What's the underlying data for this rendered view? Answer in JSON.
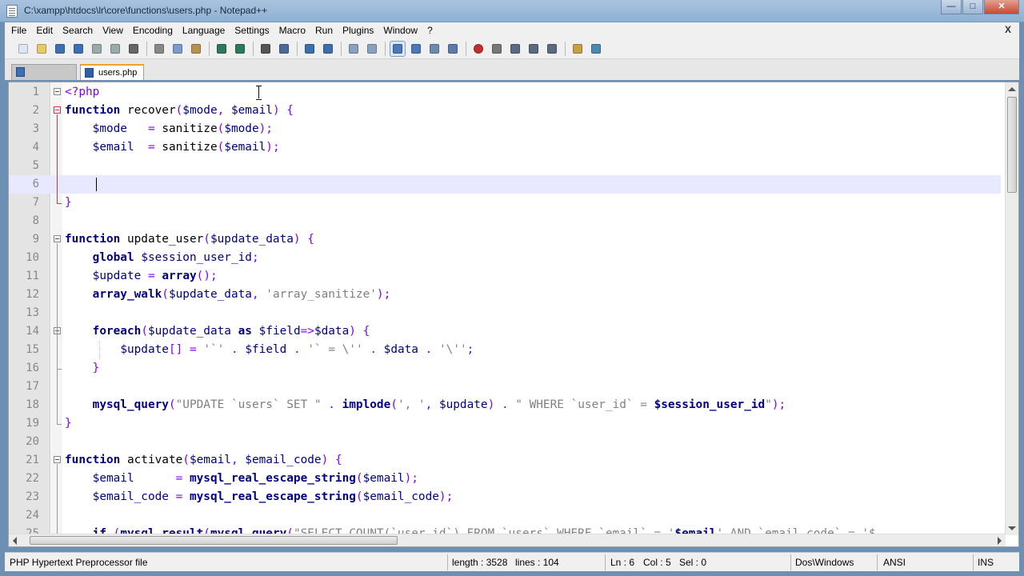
{
  "window": {
    "title": "C:\\xampp\\htdocs\\lr\\core\\functions\\users.php - Notepad++"
  },
  "menu": [
    "File",
    "Edit",
    "Search",
    "View",
    "Encoding",
    "Language",
    "Settings",
    "Macro",
    "Run",
    "Plugins",
    "Window",
    "?"
  ],
  "menu_close": "X",
  "tabs": [
    {
      "label": "",
      "active": false
    },
    {
      "label": "users.php",
      "active": true
    }
  ],
  "toolbar_icons": [
    "new-file-icon",
    "open-file-icon",
    "save-icon",
    "save-all-icon",
    "close-icon",
    "close-all-icon",
    "print-icon",
    "cut-icon",
    "copy-icon",
    "paste-icon",
    "undo-icon",
    "redo-icon",
    "find-icon",
    "replace-icon",
    "zoom-in-icon",
    "zoom-out-icon",
    "sync-vertical-icon",
    "sync-horizontal-icon",
    "word-wrap-icon",
    "show-all-chars-icon",
    "indent-guide-icon",
    "user-defined-language-icon",
    "record-macro-icon",
    "stop-macro-icon",
    "play-macro-icon",
    "run-macro-multiple-icon",
    "save-macro-icon",
    "open-folder-icon",
    "spell-check-icon"
  ],
  "editor": {
    "current_line": 6,
    "lines": [
      {
        "n": "1",
        "html": "<span class=\"op\">&lt;?php</span>"
      },
      {
        "n": "2",
        "html": "<span class=\"kw\">function</span> recover<span class=\"op\">(</span><span class=\"var\">$mode</span><span class=\"op\">,</span> <span class=\"var\">$email</span><span class=\"op\">)</span> <span class=\"op\">{</span>"
      },
      {
        "n": "3",
        "html": "    <span class=\"var\">$mode</span>   <span class=\"op\">=</span> sanitize<span class=\"op\">(</span><span class=\"var\">$mode</span><span class=\"op\">);</span>"
      },
      {
        "n": "4",
        "html": "    <span class=\"var\">$email</span>  <span class=\"op\">=</span> sanitize<span class=\"op\">(</span><span class=\"var\">$email</span><span class=\"op\">);</span>"
      },
      {
        "n": "5",
        "html": ""
      },
      {
        "n": "6",
        "html": ""
      },
      {
        "n": "7",
        "html": "<span class=\"op\">}</span>"
      },
      {
        "n": "8",
        "html": ""
      },
      {
        "n": "9",
        "html": "<span class=\"kw\">function</span> update_user<span class=\"op\">(</span><span class=\"var\">$update_data</span><span class=\"op\">)</span> <span class=\"op\">{</span>"
      },
      {
        "n": "10",
        "html": "    <span class=\"kw\">global</span> <span class=\"var\">$session_user_id</span><span class=\"op\">;</span>"
      },
      {
        "n": "11",
        "html": "    <span class=\"var\">$update</span> <span class=\"op\">=</span> <span class=\"cmd\">array</span><span class=\"op\">();</span>"
      },
      {
        "n": "12",
        "html": "    <span class=\"cmd\">array_walk</span><span class=\"op\">(</span><span class=\"var\">$update_data</span><span class=\"op\">,</span> <span class=\"str\">'array_sanitize'</span><span class=\"op\">);</span>"
      },
      {
        "n": "13",
        "html": ""
      },
      {
        "n": "14",
        "html": "    <span class=\"kw\">foreach</span><span class=\"op\">(</span><span class=\"var\">$update_data</span> <span class=\"kw\">as</span> <span class=\"var\">$field</span><span class=\"op\">=&gt;</span><span class=\"var\">$data</span><span class=\"op\">)</span> <span class=\"op\">{</span>"
      },
      {
        "n": "15",
        "html": "        <span class=\"var\">$update</span><span class=\"op\">[]</span> <span class=\"op\">=</span> <span class=\"str\">'`'</span> <span class=\"op\">.</span> <span class=\"var\">$field</span> <span class=\"op\">.</span> <span class=\"str\">'` = \\''</span> <span class=\"op\">.</span> <span class=\"var\">$data</span> <span class=\"op\">.</span> <span class=\"str\">'\\''</span><span class=\"op\">;</span>"
      },
      {
        "n": "16",
        "html": "    <span class=\"op\">}</span>"
      },
      {
        "n": "17",
        "html": ""
      },
      {
        "n": "18",
        "html": "    <span class=\"cmd\">mysql_query</span><span class=\"op\">(</span><span class=\"str\">\"UPDATE `users` SET \"</span> <span class=\"op\">.</span> <span class=\"cmd\">implode</span><span class=\"op\">(</span><span class=\"str\">', '</span><span class=\"op\">,</span> <span class=\"var\">$update</span><span class=\"op\">)</span> <span class=\"op\">.</span> <span class=\"str\">\" WHERE `user_id` = </span><span class=\"cmd\">$session_user_id</span><span class=\"str\">\"</span><span class=\"op\">);</span>"
      },
      {
        "n": "19",
        "html": "<span class=\"op\">}</span>"
      },
      {
        "n": "20",
        "html": ""
      },
      {
        "n": "21",
        "html": "<span class=\"kw\">function</span> activate<span class=\"op\">(</span><span class=\"var\">$email</span><span class=\"op\">,</span> <span class=\"var\">$email_code</span><span class=\"op\">)</span> <span class=\"op\">{</span>"
      },
      {
        "n": "22",
        "html": "    <span class=\"var\">$email</span>      <span class=\"op\">=</span> <span class=\"cmd\">mysql_real_escape_string</span><span class=\"op\">(</span><span class=\"var\">$email</span><span class=\"op\">);</span>"
      },
      {
        "n": "23",
        "html": "    <span class=\"var\">$email_code</span> <span class=\"op\">=</span> <span class=\"cmd\">mysql_real_escape_string</span><span class=\"op\">(</span><span class=\"var\">$email_code</span><span class=\"op\">);</span>"
      },
      {
        "n": "24",
        "html": ""
      },
      {
        "n": "25",
        "html": "    <span class=\"kw\">if</span> <span class=\"op\">(</span><span class=\"cmd\">mysql_result</span><span class=\"op\">(</span><span class=\"cmd\">mysql_query</span><span class=\"op\">(</span><span class=\"str\">\"SELECT COUNT(`user_id`) FROM `users` WHERE `email` = '</span><span class=\"cmd\">$email</span><span class=\"str\">' AND `email_code` = '$</span>"
      }
    ]
  },
  "status": {
    "file_type": "PHP Hypertext Preprocessor file",
    "length": "length : 3528",
    "lines": "lines : 104",
    "ln": "Ln : 6",
    "col": "Col : 5",
    "sel": "Sel : 0",
    "eol": "Dos\\Windows",
    "encoding": "ANSI",
    "mode": "INS"
  }
}
